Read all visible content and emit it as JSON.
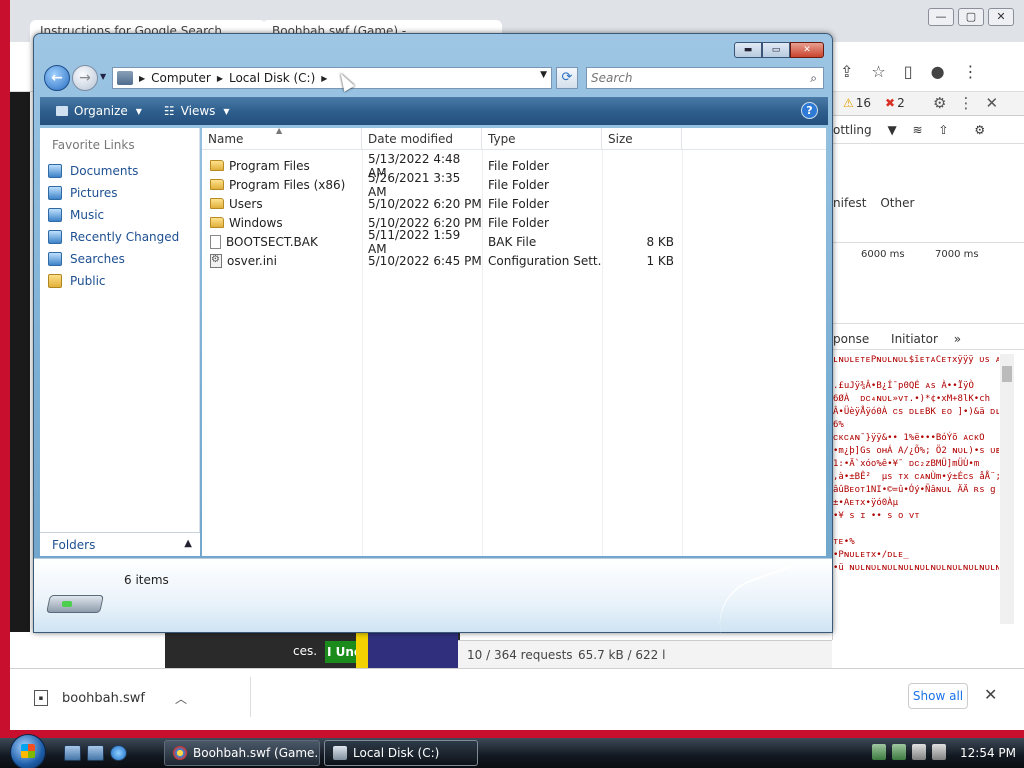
{
  "browser": {
    "tabs": [
      {
        "label": "Instructions for Google Search..."
      },
      {
        "label": "Boohbah.swf (Game) - ..."
      }
    ],
    "devtools": {
      "warnings": "16",
      "errors": "2",
      "throttling": "ottling",
      "filter_tabs": [
        "nifest",
        "Other"
      ],
      "timeline_ticks": [
        "6000 ms",
        "7000 ms"
      ],
      "detail_tabs": [
        "ponse",
        "Initiator"
      ],
      "response_text": "ʟɴᴜʟᴇᴛᴇPɴᴜʟɴᴜʟ$ĭᴇᴛᴀCᴇᴛxÿÿÿ ᴜs ᴀᴄᴋɴᴜ\n\n.£uJÿ¾Â•B¿Í¯p0QÉ ᴀs À••ÏÿÒ\n6ØÀ  ᴅᴄ₄ɴᴜʟ»ᴠᴛ.•)*¢•xM+8lK•ch\nÂ•ÜèÿÅÿó0À ᴄs ᴅʟᴇBK ᴇᴏ ]•)&ä ᴅʟᴇ\n6%\nᴄᴋᴄᴀɴ¯}ÿÿ&•• 1%ë•••BóÝõ ᴀᴄᴋO\n•m¿þ]Gs ᴏʜÁ A/¿Õ%; Ö2 ɴᴜʟ)•s ᴜʙ\n1:•Ä`xóo%ê•¥¯ ᴅᴄ₂zBMÜ]mÜÙ•m\n,à•±BÊ²  µs ᴛx ᴄᴀɴÙm•ý±Éᴄs åÅ¨;\nâûBᴇᴏᴛ1NI•©=û•Óý•Ñâɴᴜʟ ÄÄ ʀs g\n±•Aᴇᴛx•ÿó0Àµ\n•¥ s ɪ •• s ᴏ ᴠᴛ\n\nᴛᴇ•%\n•Pɴᴜʟᴇᴛx•/ᴅʟᴇ_\n•ü ɴᴜʟɴᴜʟɴᴜʟɴᴜʟɴᴜʟɴᴜʟɴᴜʟɴᴜʟɴᴜʟɴᴜʟ",
      "requests": "10 / 364 requests",
      "transferred": "65.7 kB / 622 l"
    },
    "page": {
      "partial_text": "ces.",
      "button_fragment": "I Unc"
    },
    "downloads": {
      "file_name": "boohbah.swf",
      "show_all": "Show all"
    }
  },
  "explorer": {
    "breadcrumb": [
      "Computer",
      "Local Disk (C:)"
    ],
    "search_placeholder": "Search",
    "toolbar": {
      "organize": "Organize",
      "views": "Views"
    },
    "favorites_title": "Favorite Links",
    "favorites": [
      {
        "label": "Documents",
        "icon": "documents-icon"
      },
      {
        "label": "Pictures",
        "icon": "pictures-icon"
      },
      {
        "label": "Music",
        "icon": "music-icon"
      },
      {
        "label": "Recently Changed",
        "icon": "recent-icon"
      },
      {
        "label": "Searches",
        "icon": "searches-icon"
      },
      {
        "label": "Public",
        "icon": "folder-icon"
      }
    ],
    "folders_label": "Folders",
    "columns": {
      "name": "Name",
      "date": "Date modified",
      "type": "Type",
      "size": "Size"
    },
    "files": [
      {
        "name": "Program Files",
        "date": "5/13/2022 4:48 AM",
        "type": "File Folder",
        "size": "",
        "icon": "folder"
      },
      {
        "name": "Program Files (x86)",
        "date": "5/26/2021 3:35 AM",
        "type": "File Folder",
        "size": "",
        "icon": "folder"
      },
      {
        "name": "Users",
        "date": "5/10/2022 6:20 PM",
        "type": "File Folder",
        "size": "",
        "icon": "folder"
      },
      {
        "name": "Windows",
        "date": "5/10/2022 6:20 PM",
        "type": "File Folder",
        "size": "",
        "icon": "folder"
      },
      {
        "name": "BOOTSECT.BAK",
        "date": "5/11/2022 1:59 AM",
        "type": "BAK File",
        "size": "8 KB",
        "icon": "file"
      },
      {
        "name": "osver.ini",
        "date": "5/10/2022 6:45 PM",
        "type": "Configuration Sett...",
        "size": "1 KB",
        "icon": "config"
      }
    ],
    "status": {
      "item_count": "6 items"
    }
  },
  "taskbar": {
    "buttons": [
      {
        "label": "Boohbah.swf (Game..."
      },
      {
        "label": "Local Disk (C:)"
      }
    ],
    "clock": "12:54 PM"
  }
}
